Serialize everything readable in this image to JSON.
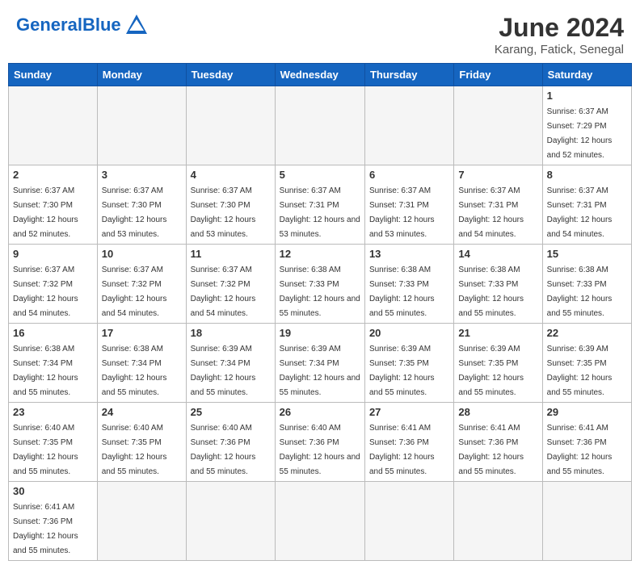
{
  "header": {
    "logo_general": "General",
    "logo_blue": "Blue",
    "title": "June 2024",
    "subtitle": "Karang, Fatick, Senegal"
  },
  "weekdays": [
    "Sunday",
    "Monday",
    "Tuesday",
    "Wednesday",
    "Thursday",
    "Friday",
    "Saturday"
  ],
  "weeks": [
    [
      {
        "day": null,
        "info": null
      },
      {
        "day": null,
        "info": null
      },
      {
        "day": null,
        "info": null
      },
      {
        "day": null,
        "info": null
      },
      {
        "day": null,
        "info": null
      },
      {
        "day": null,
        "info": null
      },
      {
        "day": "1",
        "info": "Sunrise: 6:37 AM\nSunset: 7:29 PM\nDaylight: 12 hours and 52 minutes."
      }
    ],
    [
      {
        "day": "2",
        "info": "Sunrise: 6:37 AM\nSunset: 7:30 PM\nDaylight: 12 hours and 52 minutes."
      },
      {
        "day": "3",
        "info": "Sunrise: 6:37 AM\nSunset: 7:30 PM\nDaylight: 12 hours and 53 minutes."
      },
      {
        "day": "4",
        "info": "Sunrise: 6:37 AM\nSunset: 7:30 PM\nDaylight: 12 hours and 53 minutes."
      },
      {
        "day": "5",
        "info": "Sunrise: 6:37 AM\nSunset: 7:31 PM\nDaylight: 12 hours and 53 minutes."
      },
      {
        "day": "6",
        "info": "Sunrise: 6:37 AM\nSunset: 7:31 PM\nDaylight: 12 hours and 53 minutes."
      },
      {
        "day": "7",
        "info": "Sunrise: 6:37 AM\nSunset: 7:31 PM\nDaylight: 12 hours and 54 minutes."
      },
      {
        "day": "8",
        "info": "Sunrise: 6:37 AM\nSunset: 7:31 PM\nDaylight: 12 hours and 54 minutes."
      }
    ],
    [
      {
        "day": "9",
        "info": "Sunrise: 6:37 AM\nSunset: 7:32 PM\nDaylight: 12 hours and 54 minutes."
      },
      {
        "day": "10",
        "info": "Sunrise: 6:37 AM\nSunset: 7:32 PM\nDaylight: 12 hours and 54 minutes."
      },
      {
        "day": "11",
        "info": "Sunrise: 6:37 AM\nSunset: 7:32 PM\nDaylight: 12 hours and 54 minutes."
      },
      {
        "day": "12",
        "info": "Sunrise: 6:38 AM\nSunset: 7:33 PM\nDaylight: 12 hours and 55 minutes."
      },
      {
        "day": "13",
        "info": "Sunrise: 6:38 AM\nSunset: 7:33 PM\nDaylight: 12 hours and 55 minutes."
      },
      {
        "day": "14",
        "info": "Sunrise: 6:38 AM\nSunset: 7:33 PM\nDaylight: 12 hours and 55 minutes."
      },
      {
        "day": "15",
        "info": "Sunrise: 6:38 AM\nSunset: 7:33 PM\nDaylight: 12 hours and 55 minutes."
      }
    ],
    [
      {
        "day": "16",
        "info": "Sunrise: 6:38 AM\nSunset: 7:34 PM\nDaylight: 12 hours and 55 minutes."
      },
      {
        "day": "17",
        "info": "Sunrise: 6:38 AM\nSunset: 7:34 PM\nDaylight: 12 hours and 55 minutes."
      },
      {
        "day": "18",
        "info": "Sunrise: 6:39 AM\nSunset: 7:34 PM\nDaylight: 12 hours and 55 minutes."
      },
      {
        "day": "19",
        "info": "Sunrise: 6:39 AM\nSunset: 7:34 PM\nDaylight: 12 hours and 55 minutes."
      },
      {
        "day": "20",
        "info": "Sunrise: 6:39 AM\nSunset: 7:35 PM\nDaylight: 12 hours and 55 minutes."
      },
      {
        "day": "21",
        "info": "Sunrise: 6:39 AM\nSunset: 7:35 PM\nDaylight: 12 hours and 55 minutes."
      },
      {
        "day": "22",
        "info": "Sunrise: 6:39 AM\nSunset: 7:35 PM\nDaylight: 12 hours and 55 minutes."
      }
    ],
    [
      {
        "day": "23",
        "info": "Sunrise: 6:40 AM\nSunset: 7:35 PM\nDaylight: 12 hours and 55 minutes."
      },
      {
        "day": "24",
        "info": "Sunrise: 6:40 AM\nSunset: 7:35 PM\nDaylight: 12 hours and 55 minutes."
      },
      {
        "day": "25",
        "info": "Sunrise: 6:40 AM\nSunset: 7:36 PM\nDaylight: 12 hours and 55 minutes."
      },
      {
        "day": "26",
        "info": "Sunrise: 6:40 AM\nSunset: 7:36 PM\nDaylight: 12 hours and 55 minutes."
      },
      {
        "day": "27",
        "info": "Sunrise: 6:41 AM\nSunset: 7:36 PM\nDaylight: 12 hours and 55 minutes."
      },
      {
        "day": "28",
        "info": "Sunrise: 6:41 AM\nSunset: 7:36 PM\nDaylight: 12 hours and 55 minutes."
      },
      {
        "day": "29",
        "info": "Sunrise: 6:41 AM\nSunset: 7:36 PM\nDaylight: 12 hours and 55 minutes."
      }
    ],
    [
      {
        "day": "30",
        "info": "Sunrise: 6:41 AM\nSunset: 7:36 PM\nDaylight: 12 hours and 55 minutes."
      },
      {
        "day": null,
        "info": null
      },
      {
        "day": null,
        "info": null
      },
      {
        "day": null,
        "info": null
      },
      {
        "day": null,
        "info": null
      },
      {
        "day": null,
        "info": null
      },
      {
        "day": null,
        "info": null
      }
    ]
  ]
}
